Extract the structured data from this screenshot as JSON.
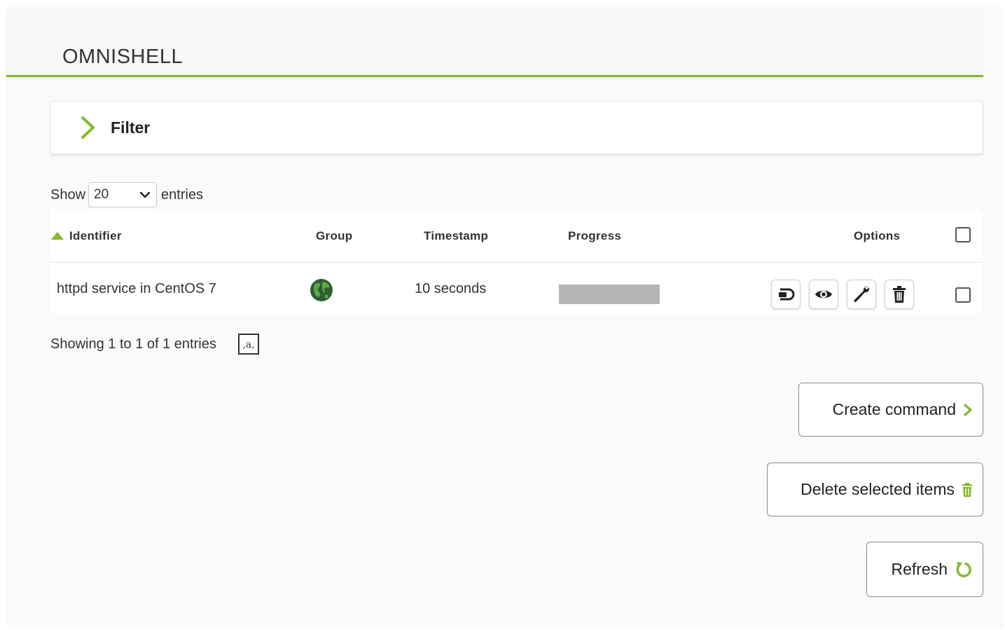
{
  "header": {
    "title": "OMNISHELL"
  },
  "filter": {
    "label": "Filter"
  },
  "length": {
    "show_label": "Show",
    "selected": "20",
    "entries_label": "entries"
  },
  "table": {
    "columns": {
      "identifier": "Identifier",
      "group": "Group",
      "timestamp": "Timestamp",
      "progress": "Progress",
      "options": "Options"
    },
    "rows": [
      {
        "identifier": "httpd service in CentOS 7",
        "group_icon": "globe-icon",
        "timestamp": "10 seconds",
        "progress": 0
      }
    ]
  },
  "info": {
    "text": "Showing 1 to 1 of 1 entries"
  },
  "actions": {
    "create": "Create command",
    "delete": "Delete selected items",
    "refresh": "Refresh"
  },
  "colors": {
    "accent": "#82b92e",
    "progress_track": "#b4b4b4"
  }
}
